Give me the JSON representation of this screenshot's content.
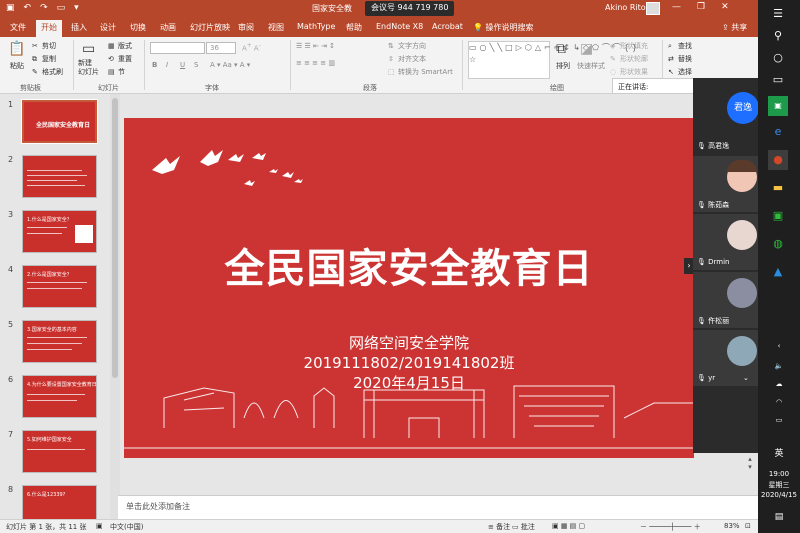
{
  "titlebar": {
    "undo": "↶",
    "redo": "↷",
    "document_title": "国家安全教",
    "meeting_id": "会议号 944 719 780",
    "user_name": "Akino Rito",
    "min": "—",
    "restore": "❐",
    "close": "✕"
  },
  "tabs": [
    "文件",
    "开始",
    "插入",
    "设计",
    "切换",
    "动画",
    "幻灯片放映",
    "审阅",
    "视图",
    "MathType",
    "帮助",
    "EndNote X8",
    "Acrobat"
  ],
  "search_placeholder": "操作说明搜索",
  "share_label": "共享",
  "ribbon": {
    "paste": "粘贴",
    "cut": "剪切",
    "copy": "复制",
    "format_painter": "格式刷",
    "new_slide": "新建\n幻灯片",
    "layout": "版式",
    "reset": "重置",
    "section": "节",
    "font_size": "36",
    "text_direction": "文字方向",
    "align_text": "对齐文本",
    "convert_smartart": "转换为 SmartArt",
    "arrange": "排列",
    "quick_styles": "快速样式",
    "shape_fill": "形状填充",
    "shape_outline": "形状轮廓",
    "shape_effects": "形状效果",
    "find": "查找",
    "replace": "替换",
    "select": "选择",
    "bold": "B",
    "italic": "I",
    "underline": "U",
    "strike": "S",
    "groups": {
      "clipboard": "剪贴板",
      "slides": "幻灯片",
      "font": "字体",
      "paragraph": "段落",
      "drawing": "绘图"
    }
  },
  "thumbnails": [
    {
      "num": "1",
      "text": "全民国家安全教育日"
    },
    {
      "num": "2",
      "text": ""
    },
    {
      "num": "3",
      "text": "1.什么是国家安全？"
    },
    {
      "num": "4",
      "text": "2.什么是国家安全？"
    },
    {
      "num": "5",
      "text": "3.国家安全的基本内容"
    },
    {
      "num": "6",
      "text": "4.为什么要设置国家安全教育日"
    },
    {
      "num": "7",
      "text": "5.如何维护国家安全"
    },
    {
      "num": "8",
      "text": "6.什么是12339?"
    }
  ],
  "slide": {
    "title": "全民国家安全教育日",
    "line1": "网络空间安全学院",
    "line2": "2019111802/2019141802班",
    "line3": "2020年4月15日"
  },
  "notes_placeholder": "单击此处添加备注",
  "status": {
    "slide_info": "幻灯片 第 1 张，共 11 张",
    "language": "中文(中国)",
    "notes": "备注",
    "comments": "批注",
    "zoom": "83%"
  },
  "meeting": {
    "speaking": "正在讲话:",
    "host_avatar_text": "君逸",
    "participants": [
      "高君逸",
      "陈茹森",
      "Drmin",
      "仵松丽",
      "yr"
    ]
  },
  "taskbar": {
    "input_method": "英",
    "time": "19:00",
    "weekday": "星期三",
    "date": "2020/4/15"
  },
  "colors": {
    "accent": "#b7472a",
    "slide_bg": "#cc3333"
  }
}
